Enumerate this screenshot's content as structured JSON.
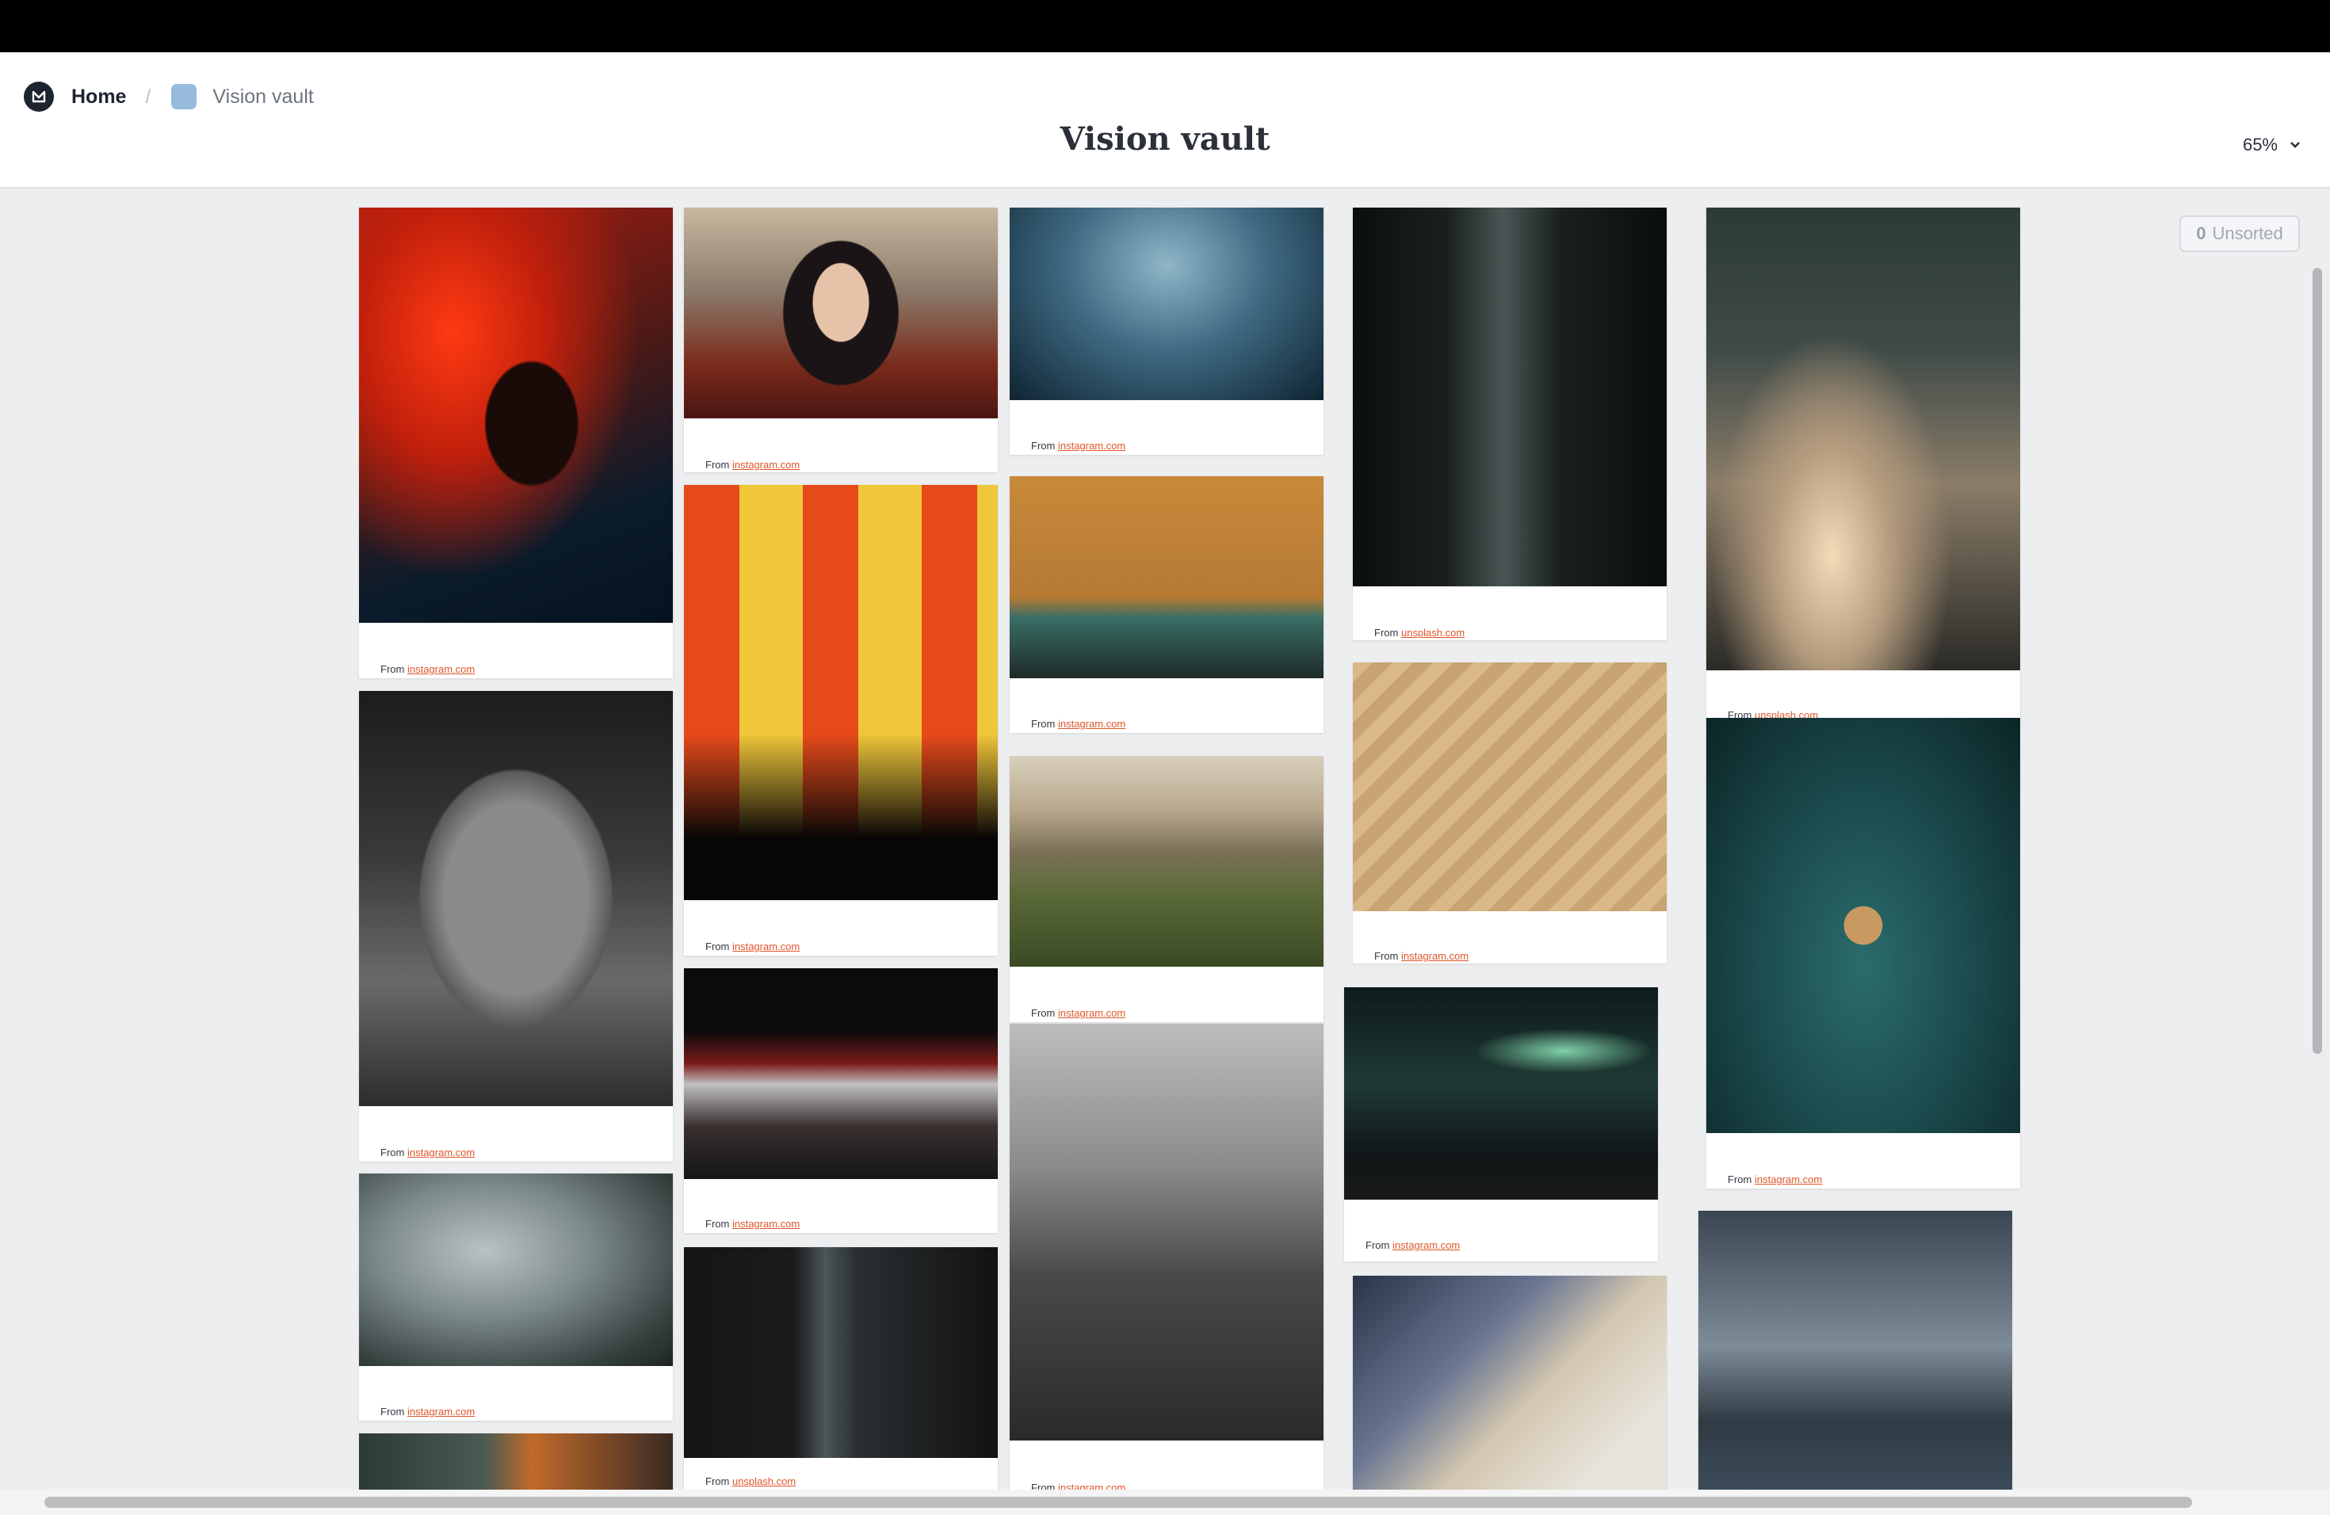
{
  "breadcrumb": {
    "home_label": "Home",
    "separator": "/",
    "board_label": "Vision vault",
    "board_icon_color": "#97bbdc"
  },
  "page_title": "Vision vault",
  "zoom": {
    "value": "65%"
  },
  "unsorted": {
    "count": "0",
    "label": "Unsorted"
  },
  "caption_prefix": "From",
  "cards": [
    {
      "source": "instagram.com",
      "image": "neon-silhouette"
    },
    {
      "source": "instagram.com",
      "image": "elephant"
    },
    {
      "source": "instagram.com",
      "image": "foggy-road"
    },
    {
      "source": "instagram.com",
      "image": "woman-portrait"
    },
    {
      "source": "instagram.com",
      "image": "trumpet-silhouettes"
    },
    {
      "source": "instagram.com",
      "image": "train-platform"
    },
    {
      "source": "unsplash.com",
      "image": "dark-window"
    },
    {
      "source": "instagram.com",
      "image": "birds-sky"
    },
    {
      "source": "instagram.com",
      "image": "orange-building"
    },
    {
      "source": "instagram.com",
      "image": "mountain-valley"
    },
    {
      "source": "instagram.com",
      "image": "boy-shipwreck"
    },
    {
      "source": "unsplash.com",
      "image": "forest-road"
    },
    {
      "source": "instagram.com",
      "image": "stairs-women"
    },
    {
      "source": "instagram.com",
      "image": "aurora-tent"
    },
    {
      "source": "unsplash.com",
      "image": "clouds-moon"
    },
    {
      "source": "instagram.com",
      "image": "teal-fabric"
    }
  ]
}
